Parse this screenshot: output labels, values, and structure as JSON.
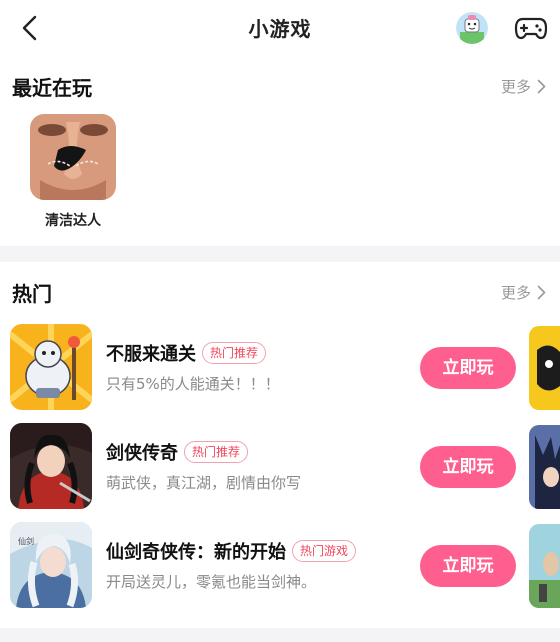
{
  "header": {
    "title": "小游戏",
    "back_icon": "chevron-left-icon",
    "avatar_icon": "user-avatar",
    "gamepad_icon": "gamepad-icon"
  },
  "recent": {
    "title": "最近在玩",
    "more_label": "更多",
    "games": [
      {
        "name": "清洁达人"
      }
    ]
  },
  "hot": {
    "title": "热门",
    "more_label": "更多",
    "games": [
      {
        "name": "不服来通关",
        "badge": "热门推荐",
        "desc": "只有5%的人能通关！！！",
        "button": "立即玩"
      },
      {
        "name": "剑侠传奇",
        "badge": "热门推荐",
        "desc": "萌武侠，真江湖，剧情由你写",
        "button": "立即玩"
      },
      {
        "name": "仙剑奇侠传：新的开始",
        "badge": "热门游戏",
        "desc": "开局送灵儿，零氪也能当剑神。",
        "button": "立即玩"
      }
    ]
  },
  "colors": {
    "accent": "#ff5f8f",
    "badge_text": "#f0475c",
    "secondary_text": "#8a8a8a",
    "background": "#f4f4f6"
  }
}
